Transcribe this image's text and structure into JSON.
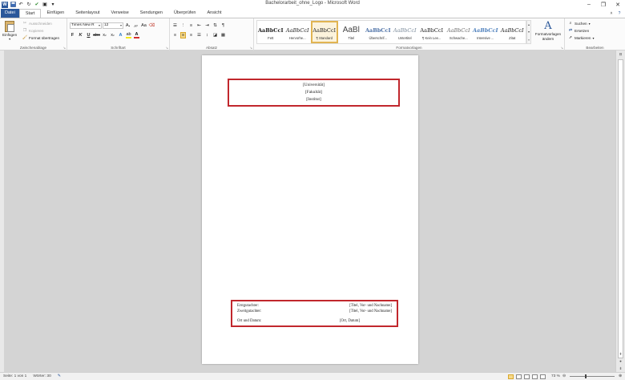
{
  "window": {
    "title": "Bachelorarbeit_ohne_Logo - Microsoft Word",
    "controls": [
      "–",
      "❐",
      "✕"
    ]
  },
  "tabs": [
    {
      "label": "Datei"
    },
    {
      "label": "Start"
    },
    {
      "label": "Einfügen"
    },
    {
      "label": "Seitenlayout"
    },
    {
      "label": "Verweise"
    },
    {
      "label": "Sendungen"
    },
    {
      "label": "Überprüfen"
    },
    {
      "label": "Ansicht"
    }
  ],
  "ribbon": {
    "clipboard": {
      "label": "Zwischenablage",
      "paste": "Einfügen",
      "cut": "Ausschneiden",
      "copy": "Kopieren",
      "format_painter": "Format übertragen"
    },
    "font": {
      "label": "Schriftart",
      "font_name": "Times New R",
      "font_size": "12"
    },
    "paragraph": {
      "label": "Absatz"
    },
    "styles": {
      "label": "Formatvorlagen",
      "items": [
        {
          "sample": "AaBbCcI",
          "name": "Fett"
        },
        {
          "sample": "AaBbCcI",
          "name": "Hervorhe..."
        },
        {
          "sample": "AaBbCcI",
          "name": "¶ Standard"
        },
        {
          "sample": "AaBl",
          "name": "Titel"
        },
        {
          "sample": "AaBbCcI",
          "name": "Überschrif..."
        },
        {
          "sample": "AaBbCcI",
          "name": "Untertitel"
        },
        {
          "sample": "AaBbCcI",
          "name": "¶ Kein Lee..."
        },
        {
          "sample": "AaBbCcI",
          "name": "Schwache..."
        },
        {
          "sample": "AaBbCcI",
          "name": "Intensive ..."
        },
        {
          "sample": "AaBbCcI",
          "name": "Zitat"
        }
      ],
      "change_styles": "Formatvorlagen ändern"
    },
    "editing": {
      "label": "Bearbeiten",
      "find": "Suchen",
      "replace": "Ersetzen",
      "select": "Markieren"
    }
  },
  "document": {
    "header_lines": [
      "[Universität]",
      "[Fakultät]",
      "[Institut]"
    ],
    "signatures": [
      {
        "label": "Erstgutachter:",
        "value": "[Titel, Vor- und Nachname]"
      },
      {
        "label": "Zweitgutachter:",
        "value": "[Titel, Vor- und Nachname]"
      },
      {
        "label": "Ort und Datum:",
        "value": "[Ort, Datum]"
      }
    ]
  },
  "status": {
    "page": "Seite: 1 von 1",
    "words": "Wörter: 30",
    "zoom": "73 %",
    "zoom_level": 0.73
  },
  "colors": {
    "accent": "#2b579a",
    "highlight_box": "#c1272d",
    "active_style": "#e1b452"
  }
}
